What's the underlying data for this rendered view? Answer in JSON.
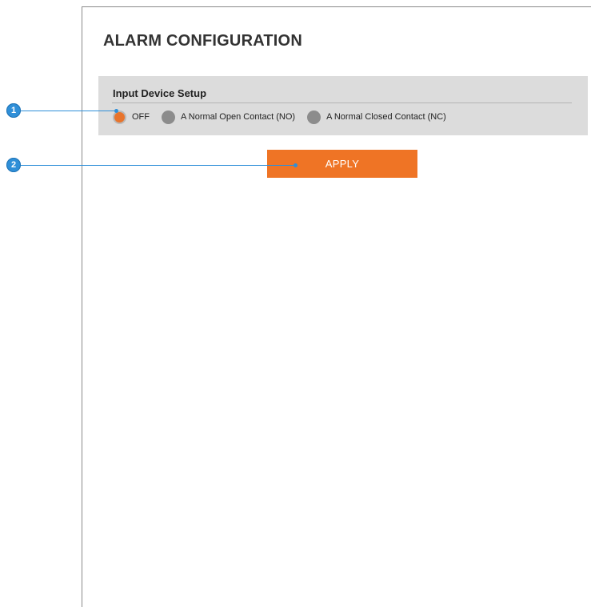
{
  "page": {
    "title": "ALARM CONFIGURATION"
  },
  "input_device_setup": {
    "title": "Input Device Setup",
    "options": [
      {
        "label": "OFF",
        "selected": true
      },
      {
        "label": "A Normal Open Contact (NO)",
        "selected": false
      },
      {
        "label": "A Normal Closed Contact (NC)",
        "selected": false
      }
    ]
  },
  "actions": {
    "apply_label": "APPLY"
  },
  "callouts": [
    {
      "number": "1"
    },
    {
      "number": "2"
    }
  ],
  "colors": {
    "accent_orange": "#ef7425",
    "panel_gray": "#dcdcdc",
    "callout_blue": "#2f8fd8",
    "radio_unselected": "#8c8c8c"
  }
}
